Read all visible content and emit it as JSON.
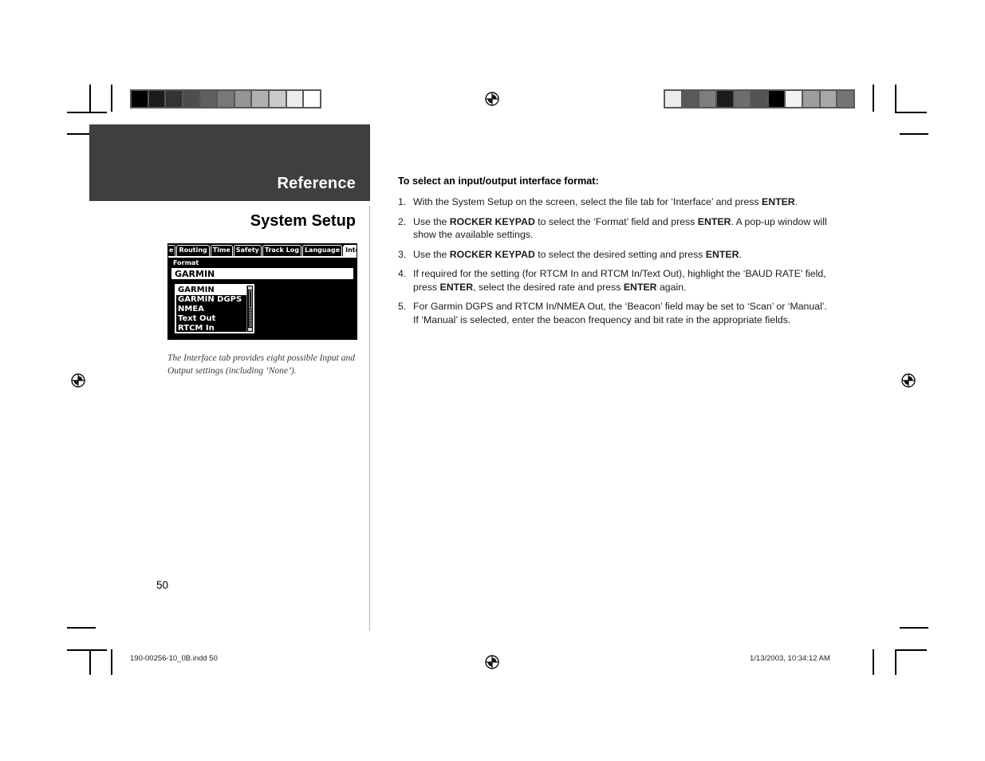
{
  "document": {
    "page_number": "50",
    "section_band_title": "Reference",
    "section_subtitle": "System Setup",
    "band_color": "#3f3f3f"
  },
  "footer": {
    "file_name": "190-00256-10_0B.indd   50",
    "timestamp": "1/13/2003, 10:34:12 AM"
  },
  "calibration_bars": {
    "left": [
      "#000000",
      "#1c1c1c",
      "#333333",
      "#4d4d4d",
      "#5f5f5f",
      "#787878",
      "#959595",
      "#b0b0b0",
      "#c9c9c9",
      "#ececec",
      "#ffffff"
    ],
    "right": [
      "#ececec",
      "#5a5a5a",
      "#7e7e7e",
      "#1c1c1c",
      "#6e6e6e",
      "#545454",
      "#000000",
      "#f2f2f2",
      "#9d9d9d",
      "#a8a8a8",
      "#757575"
    ]
  },
  "gps_screen": {
    "tabs": [
      {
        "label": "e",
        "active": false,
        "clipped": true
      },
      {
        "label": "Routing",
        "active": false,
        "clipped": false
      },
      {
        "label": "Time",
        "active": false,
        "clipped": false
      },
      {
        "label": "Safety",
        "active": false,
        "clipped": false
      },
      {
        "label": "Track Log",
        "active": false,
        "clipped": false
      },
      {
        "label": "Language",
        "active": false,
        "clipped": false
      },
      {
        "label": "Interface",
        "active": true,
        "clipped": false
      }
    ],
    "field_label": "Format",
    "field_value": "GARMIN",
    "dropdown_options": [
      {
        "label": "GARMIN",
        "selected": true
      },
      {
        "label": "GARMIN DGPS",
        "selected": false
      },
      {
        "label": "NMEA",
        "selected": false
      },
      {
        "label": "Text Out",
        "selected": false
      },
      {
        "label": "RTCM In",
        "selected": false
      }
    ],
    "caption": "The Interface tab provides eight possible Input and Output settings (including ‘None’)."
  },
  "procedure": {
    "heading": "To select an input/output interface format:",
    "steps": [
      {
        "number": "1.",
        "parts": [
          {
            "t": "With the System Setup on the screen, select the file tab for ‘Interface’ and press ",
            "b": false
          },
          {
            "t": "ENTER",
            "b": true
          },
          {
            "t": ".",
            "b": false
          }
        ]
      },
      {
        "number": "2.",
        "parts": [
          {
            "t": "Use the ",
            "b": false
          },
          {
            "t": "ROCKER KEYPAD",
            "b": true
          },
          {
            "t": " to select the ‘Format’ field and press ",
            "b": false
          },
          {
            "t": "ENTER",
            "b": true
          },
          {
            "t": ".  A pop-up window will show the available settings.",
            "b": false
          }
        ]
      },
      {
        "number": "3.",
        "parts": [
          {
            "t": "Use the ",
            "b": false
          },
          {
            "t": "ROCKER KEYPAD",
            "b": true
          },
          {
            "t": " to select the desired setting and press ",
            "b": false
          },
          {
            "t": "ENTER",
            "b": true
          },
          {
            "t": ".",
            "b": false
          }
        ]
      },
      {
        "number": "4.",
        "parts": [
          {
            "t": "If required for the setting (for RTCM In and RTCM In/Text Out), highlight the ‘BAUD RATE’ field, press ",
            "b": false
          },
          {
            "t": "ENTER",
            "b": true
          },
          {
            "t": ", select the desired rate and press ",
            "b": false
          },
          {
            "t": "ENTER",
            "b": true
          },
          {
            "t": " again.",
            "b": false
          }
        ]
      },
      {
        "number": "5.",
        "parts": [
          {
            "t": "For Garmin DGPS and RTCM In/NMEA Out, the ‘Beacon’ field may be set to ‘Scan’ or ‘Manual’.  If ‘Manual’ is selected, enter the beacon frequency and bit rate in the appropriate fields.",
            "b": false
          }
        ]
      }
    ]
  }
}
